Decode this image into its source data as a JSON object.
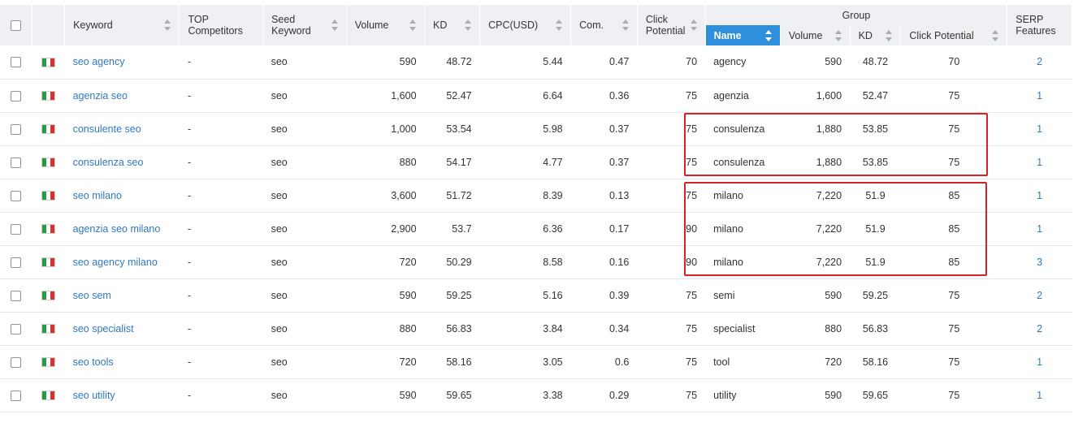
{
  "header": {
    "keyword": "Keyword",
    "top_competitors": "TOP Competitors",
    "seed_keyword": "Seed Keyword",
    "volume": "Volume",
    "kd": "KD",
    "cpc": "CPC(USD)",
    "com": "Com.",
    "click_potential": "Click Potential",
    "group": "Group",
    "group_name": "Name",
    "group_volume": "Volume",
    "group_kd": "KD",
    "group_click_potential": "Click Potential",
    "serp_features": "SERP Features"
  },
  "colors": {
    "link": "#2e79c2",
    "active_header": "#2e8fdc",
    "header_bg": "#eef0f3",
    "highlight_box": "#d32228",
    "flag": [
      "#2b9a47",
      "#ffffff",
      "#d8312e"
    ]
  },
  "rows": [
    {
      "keyword": "seo agency",
      "competitors": "-",
      "seed": "seo",
      "volume": "590",
      "kd": "48.72",
      "cpc": "5.44",
      "com": "0.47",
      "click": "70",
      "g_name": "agency",
      "g_volume": "590",
      "g_kd": "48.72",
      "g_click": "70",
      "serp": "2"
    },
    {
      "keyword": "agenzia seo",
      "competitors": "-",
      "seed": "seo",
      "volume": "1,600",
      "kd": "52.47",
      "cpc": "6.64",
      "com": "0.36",
      "click": "75",
      "g_name": "agenzia",
      "g_volume": "1,600",
      "g_kd": "52.47",
      "g_click": "75",
      "serp": "1"
    },
    {
      "keyword": "consulente seo",
      "competitors": "-",
      "seed": "seo",
      "volume": "1,000",
      "kd": "53.54",
      "cpc": "5.98",
      "com": "0.37",
      "click": "75",
      "g_name": "consulenza",
      "g_volume": "1,880",
      "g_kd": "53.85",
      "g_click": "75",
      "serp": "1"
    },
    {
      "keyword": "consulenza seo",
      "competitors": "-",
      "seed": "seo",
      "volume": "880",
      "kd": "54.17",
      "cpc": "4.77",
      "com": "0.37",
      "click": "75",
      "g_name": "consulenza",
      "g_volume": "1,880",
      "g_kd": "53.85",
      "g_click": "75",
      "serp": "1"
    },
    {
      "keyword": "seo milano",
      "competitors": "-",
      "seed": "seo",
      "volume": "3,600",
      "kd": "51.72",
      "cpc": "8.39",
      "com": "0.13",
      "click": "75",
      "g_name": "milano",
      "g_volume": "7,220",
      "g_kd": "51.9",
      "g_click": "85",
      "serp": "1"
    },
    {
      "keyword": "agenzia seo milano",
      "competitors": "-",
      "seed": "seo",
      "volume": "2,900",
      "kd": "53.7",
      "cpc": "6.36",
      "com": "0.17",
      "click": "90",
      "g_name": "milano",
      "g_volume": "7,220",
      "g_kd": "51.9",
      "g_click": "85",
      "serp": "1"
    },
    {
      "keyword": "seo agency milano",
      "competitors": "-",
      "seed": "seo",
      "volume": "720",
      "kd": "50.29",
      "cpc": "8.58",
      "com": "0.16",
      "click": "90",
      "g_name": "milano",
      "g_volume": "7,220",
      "g_kd": "51.9",
      "g_click": "85",
      "serp": "3"
    },
    {
      "keyword": "seo sem",
      "competitors": "-",
      "seed": "seo",
      "volume": "590",
      "kd": "59.25",
      "cpc": "5.16",
      "com": "0.39",
      "click": "75",
      "g_name": "semi",
      "g_volume": "590",
      "g_kd": "59.25",
      "g_click": "75",
      "serp": "2"
    },
    {
      "keyword": "seo specialist",
      "competitors": "-",
      "seed": "seo",
      "volume": "880",
      "kd": "56.83",
      "cpc": "3.84",
      "com": "0.34",
      "click": "75",
      "g_name": "specialist",
      "g_volume": "880",
      "g_kd": "56.83",
      "g_click": "75",
      "serp": "2"
    },
    {
      "keyword": "seo tools",
      "competitors": "-",
      "seed": "seo",
      "volume": "720",
      "kd": "58.16",
      "cpc": "3.05",
      "com": "0.6",
      "click": "75",
      "g_name": "tool",
      "g_volume": "720",
      "g_kd": "58.16",
      "g_click": "75",
      "serp": "1"
    },
    {
      "keyword": "seo utility",
      "competitors": "-",
      "seed": "seo",
      "volume": "590",
      "kd": "59.65",
      "cpc": "3.38",
      "com": "0.29",
      "click": "75",
      "g_name": "utility",
      "g_volume": "590",
      "g_kd": "59.65",
      "g_click": "75",
      "serp": "1"
    }
  ]
}
